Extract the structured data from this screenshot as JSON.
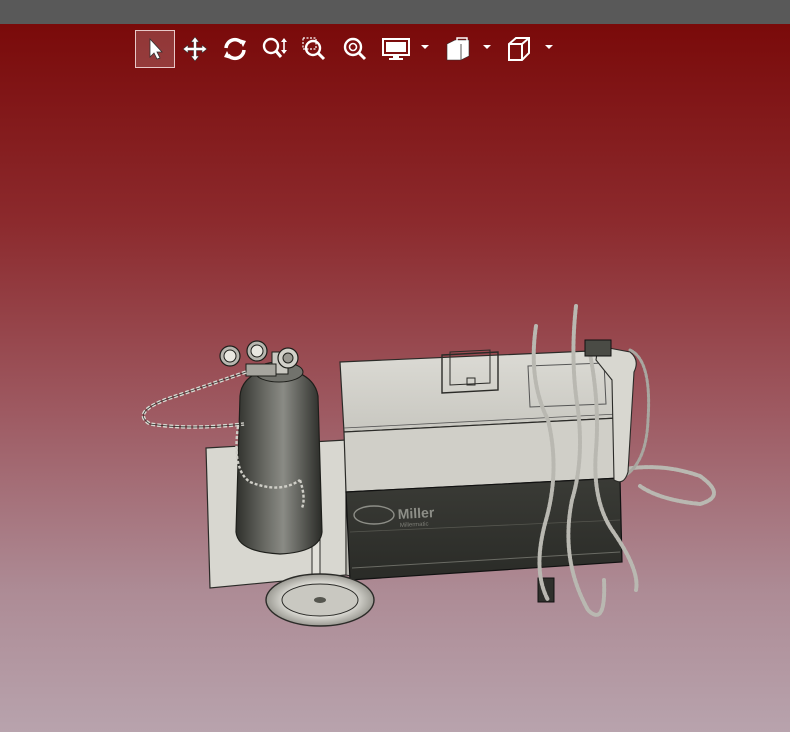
{
  "toolbar": {
    "tools": [
      {
        "icon": "select-arrow-icon",
        "active": true
      },
      {
        "icon": "pan-move-icon",
        "active": false
      },
      {
        "icon": "rotate-icon",
        "active": false
      },
      {
        "icon": "zoom-in-out-icon",
        "active": false
      },
      {
        "icon": "zoom-to-area-icon",
        "active": false
      },
      {
        "icon": "zoom-to-fit-icon",
        "active": false
      },
      {
        "icon": "display-mode-icon",
        "dropdown": true
      },
      {
        "icon": "section-view-icon",
        "dropdown": true
      },
      {
        "icon": "view-orientation-cube-icon",
        "dropdown": true
      }
    ]
  },
  "viewport": {
    "background_top": "#7a0a0a",
    "background_bottom": "#b8a3ad",
    "model": "welding cart with gas cylinder, welder unit and torch cables"
  },
  "welder_branding": {
    "brand": "Miller",
    "tagline": "Millermatic"
  }
}
